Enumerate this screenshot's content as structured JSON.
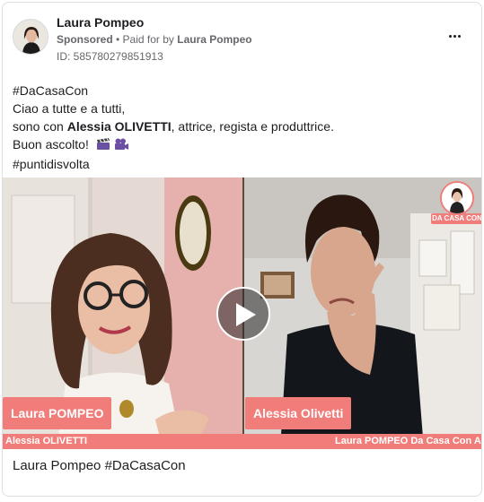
{
  "header": {
    "page_name": "Laura Pompeo",
    "sponsored": "Sponsored",
    "separator": " • ",
    "paid_for_by_label": "Paid for by ",
    "paid_for_by_name": "Laura Pompeo",
    "ad_id": "ID: 585780279851913",
    "more_icon": "more-horizontal-icon"
  },
  "post": {
    "line1": "#DaCasaCon",
    "line2": "Ciao a tutte e a tutti,",
    "line3_prefix": "sono con ",
    "line3_bold": "Alessia OLIVETTI",
    "line3_suffix": ", attrice, regista e produttrice.",
    "line4": "Buon ascolto!",
    "line4_emojis": [
      "clapperboard-icon",
      "movie-camera-icon"
    ],
    "line5": "#puntidisvolta"
  },
  "video": {
    "left_name_tag": "Laura POMPEO",
    "right_name_tag": "Alessia Olivetti",
    "ticker_left": "Alessia OLIVETTI",
    "ticker_right": "Laura POMPEO Da Casa Con A",
    "logo_text": "DA CASA CON",
    "play_icon": "play-icon",
    "accent_color": "#f17d7b"
  },
  "footer": {
    "caption": "Laura Pompeo #DaCasaCon"
  }
}
